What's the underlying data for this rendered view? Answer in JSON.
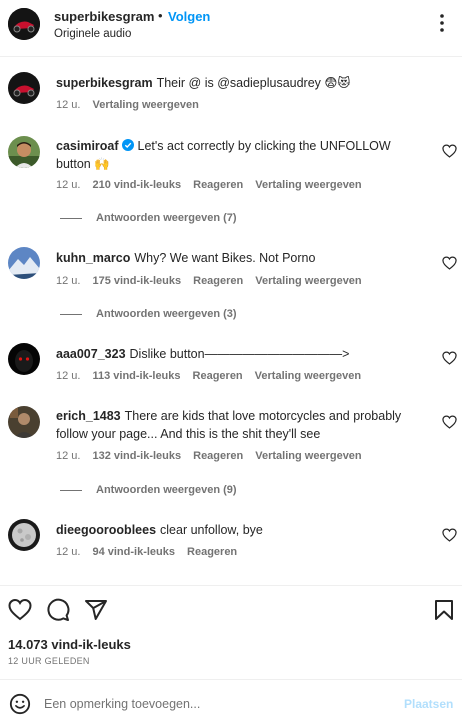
{
  "header": {
    "username": "superbikesgram",
    "separator": "•",
    "follow_label": "Volgen",
    "audio_label": "Originele audio"
  },
  "caption": {
    "username": "superbikesgram",
    "text": "Their @ is @sadieplusaudrey 😨😻",
    "time": "12 u.",
    "translate": "Vertaling weergeven"
  },
  "comments": [
    {
      "username": "casimiroaf",
      "verified": true,
      "text": "Let's act correctly by clicking the UNFOLLOW button 🙌",
      "time": "12 u.",
      "likes": "210 vind-ik-leuks",
      "reply": "Reageren",
      "translate": "Vertaling weergeven",
      "replies": "Antwoorden weergeven (7)"
    },
    {
      "username": "kuhn_marco",
      "text": "Why? We want Bikes. Not Porno",
      "time": "12 u.",
      "likes": "175 vind-ik-leuks",
      "reply": "Reageren",
      "translate": "Vertaling weergeven",
      "replies": "Antwoorden weergeven (3)"
    },
    {
      "username": "aaa007_323",
      "text": "Dislike button———————————>",
      "time": "12 u.",
      "likes": "113 vind-ik-leuks",
      "reply": "Reageren",
      "translate": "Vertaling weergeven"
    },
    {
      "username": "erich_1483",
      "text": "There are kids that love motorcycles and probably follow your page... And this is the shit they'll see",
      "time": "12 u.",
      "likes": "132 vind-ik-leuks",
      "reply": "Reageren",
      "translate": "Vertaling weergeven",
      "replies": "Antwoorden weergeven (9)"
    },
    {
      "username": "dieegoorooblees",
      "text": "clear unfollow, bye",
      "time": "12 u.",
      "likes": "94 vind-ik-leuks",
      "reply": "Reageren"
    }
  ],
  "footer": {
    "likes": "14.073 vind-ik-leuks",
    "time_ago": "12 UUR GELEDEN",
    "comment_placeholder": "Een opmerking toevoegen...",
    "post_label": "Plaatsen"
  },
  "colors": {
    "link": "#0095f6",
    "verified": "#0095f6",
    "post_disabled": "#b2dffc",
    "muted_text": "#737373"
  },
  "icons": [
    "more-icon",
    "verified-icon",
    "heart-icon",
    "like-icon",
    "comment-icon",
    "share-icon",
    "save-icon",
    "emoji-icon"
  ]
}
